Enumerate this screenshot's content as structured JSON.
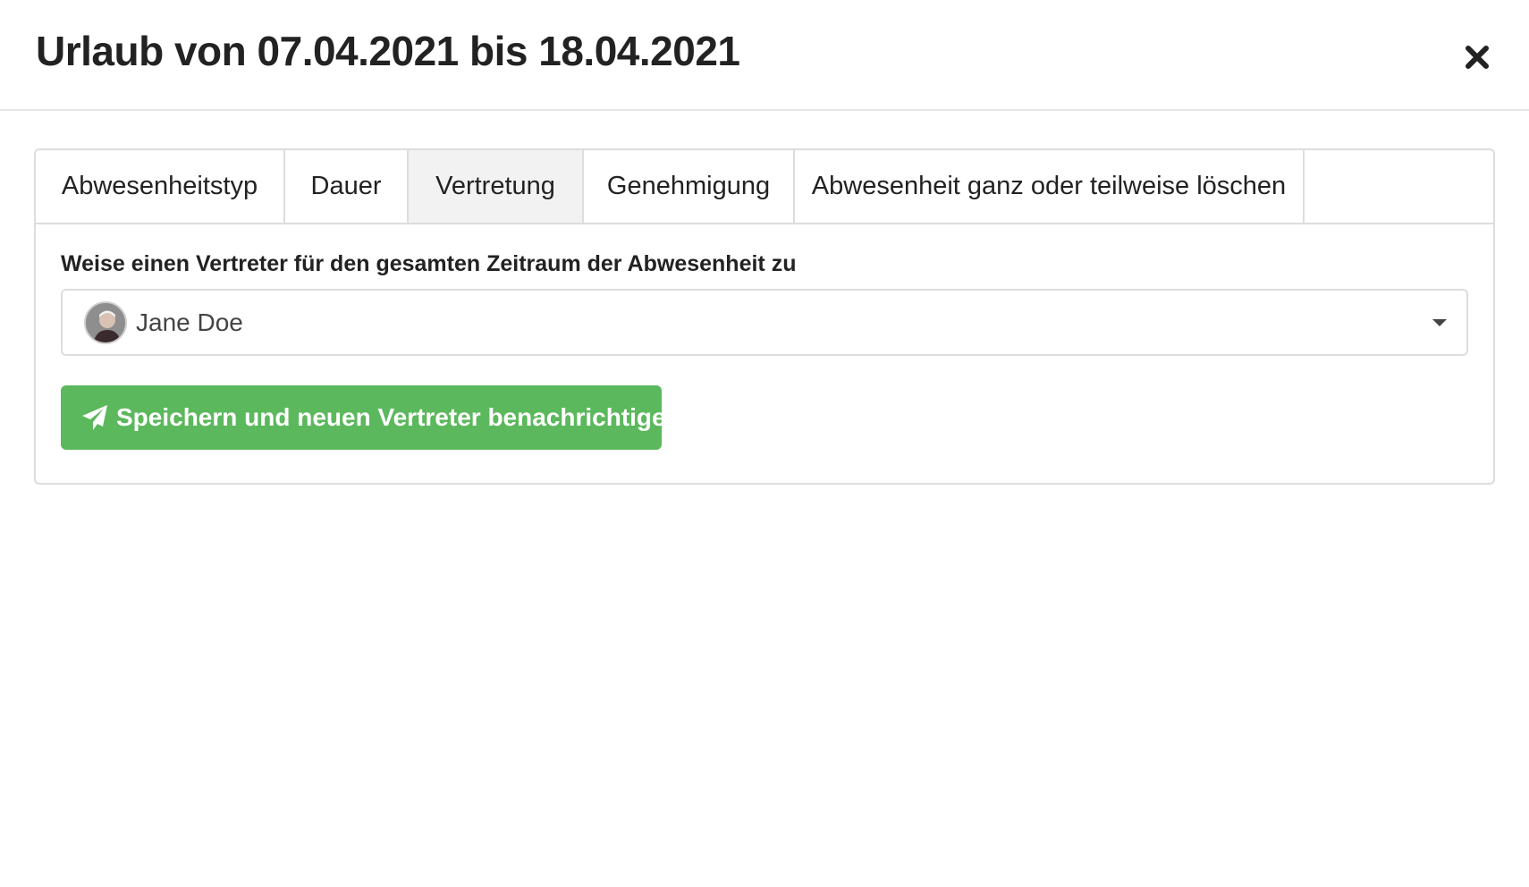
{
  "modal": {
    "title": "Urlaub von 07.04.2021 bis 18.04.2021",
    "close_icon": "close-icon"
  },
  "tabs": [
    {
      "label": "Abwesenheitstyp",
      "active": false
    },
    {
      "label": "Dauer",
      "active": false
    },
    {
      "label": "Vertretung",
      "active": true
    },
    {
      "label": "Genehmigung",
      "active": false
    },
    {
      "label": "Abwesenheit ganz oder teilweise löschen",
      "active": false
    }
  ],
  "substitute": {
    "label": "Weise einen Vertreter für den gesamten Zeitraum der Abwesenheit zu",
    "selected": "Jane Doe",
    "avatar_icon": "avatar",
    "caret_icon": "chevron-down-icon"
  },
  "actions": {
    "save_label": "Speichern und neuen Vertreter benachrichtigen",
    "save_icon": "paper-plane-icon"
  },
  "colors": {
    "accent_green": "#5cb85c",
    "active_tab_bg": "#f2f2f2",
    "border": "#dddddd"
  }
}
